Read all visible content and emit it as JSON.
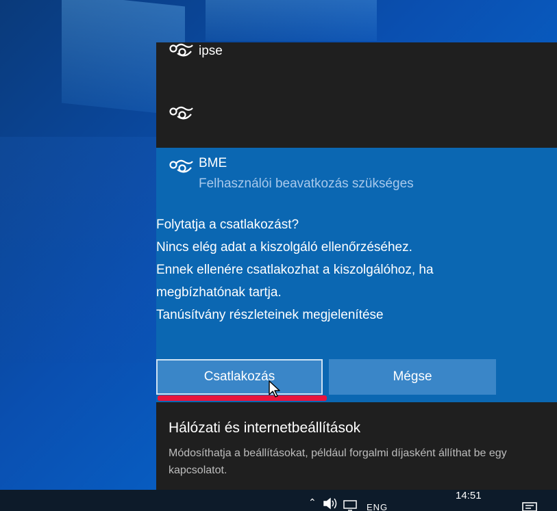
{
  "networks": {
    "ipse": {
      "name": "ipse",
      "icon": "wifi-locked-icon"
    },
    "hidden": {
      "name": "",
      "icon": "wifi-locked-icon"
    },
    "bme": {
      "name": "BME",
      "status": "Felhasználói beavatkozás szükséges",
      "icon": "wifi-locked-icon"
    }
  },
  "prompt": {
    "lines": [
      "Folytatja a csatlakozást?",
      "Nincs elég adat a kiszolgáló ellenőrzéséhez.",
      "Ennek ellenére csatlakozhat a kiszolgálóhoz, ha",
      "megbízhatónak tartja.",
      "Tanúsítvány részleteinek megjelenítése"
    ]
  },
  "buttons": {
    "connect": "Csatlakozás",
    "cancel": "Mégse"
  },
  "footer": {
    "title": "Hálózati és internetbeállítások",
    "description": "Módosíthatja a beállításokat, például forgalmi díjasként állíthat be egy kapcsolatot."
  },
  "taskbar": {
    "language": "ENG",
    "time": "14:51"
  },
  "colors": {
    "flyout_dark": "#1f1f1f",
    "flyout_accent": "#0b67b2",
    "button": "#3a86c8",
    "highlight_underline": "#e8143c"
  }
}
